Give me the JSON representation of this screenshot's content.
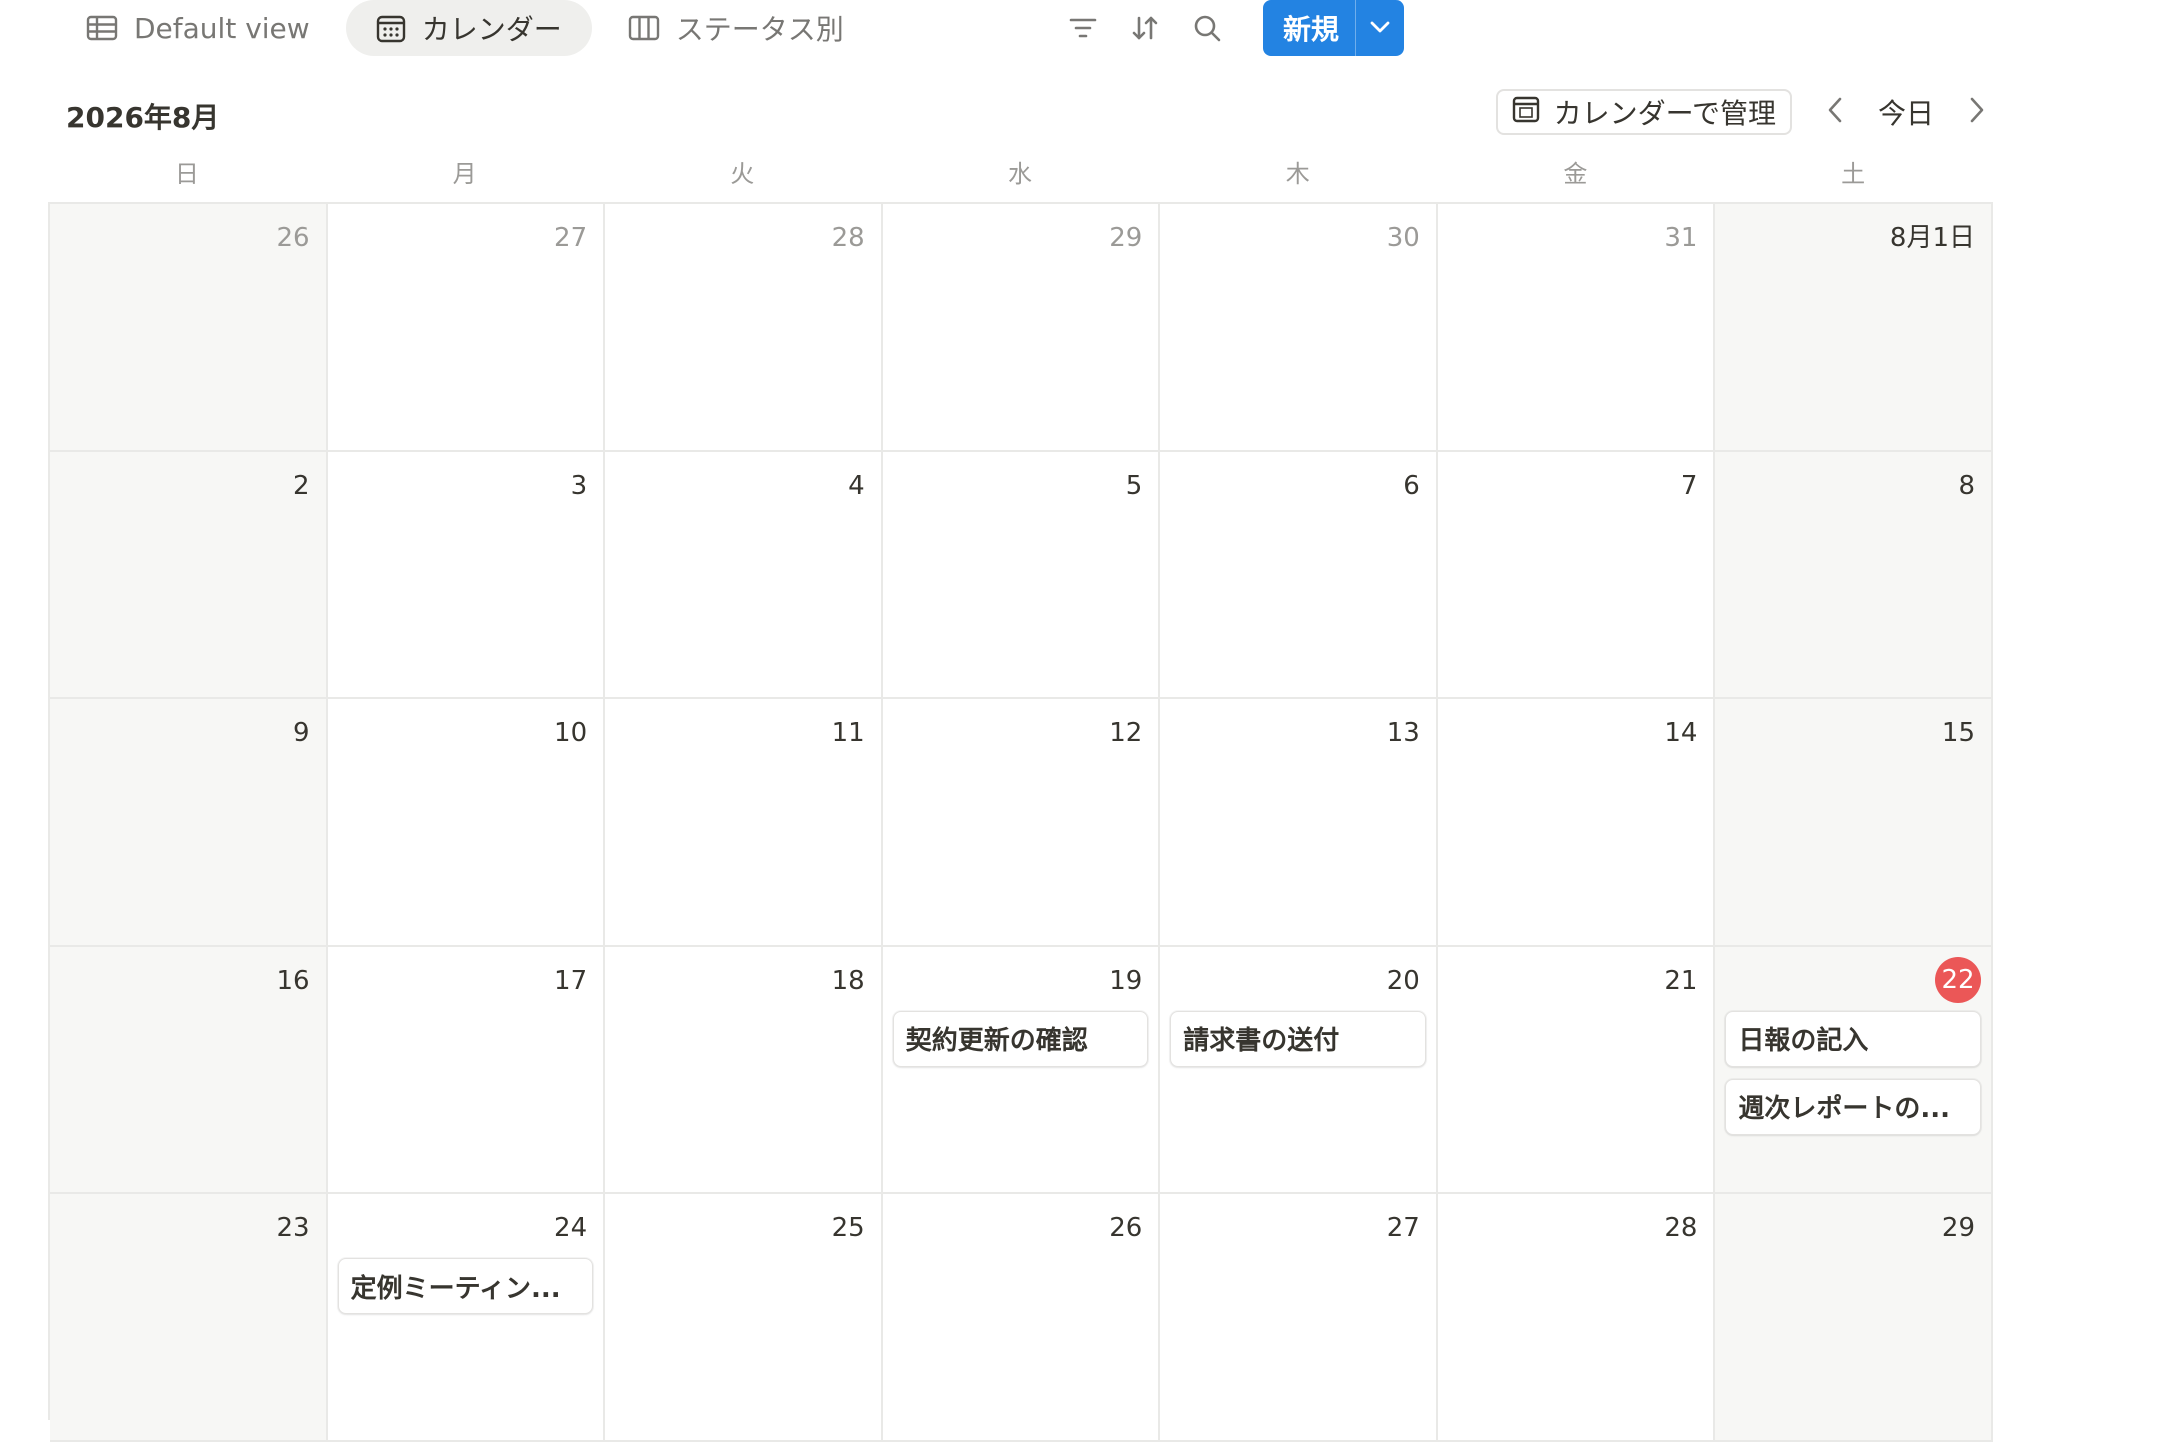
{
  "views": {
    "tabs": [
      {
        "label": "Default view",
        "icon": "table-icon"
      },
      {
        "label": "カレンダー",
        "icon": "calendar-icon"
      },
      {
        "label": "ステータス別",
        "icon": "board-icon"
      }
    ],
    "active_index": 1
  },
  "toolbar": {
    "new_label": "新規",
    "accent_color": "#2383e2"
  },
  "calendar": {
    "month_label": "2026年8月",
    "manage_label": "カレンダーで管理",
    "today_label": "今日",
    "weekdays": [
      "日",
      "月",
      "火",
      "水",
      "木",
      "金",
      "土"
    ],
    "today_color": "#eb5757",
    "weeks": [
      [
        {
          "label": "26",
          "other": true
        },
        {
          "label": "27",
          "other": true
        },
        {
          "label": "28",
          "other": true
        },
        {
          "label": "29",
          "other": true
        },
        {
          "label": "30",
          "other": true
        },
        {
          "label": "31",
          "other": true
        },
        {
          "label": "8月1日"
        }
      ],
      [
        {
          "label": "2"
        },
        {
          "label": "3"
        },
        {
          "label": "4"
        },
        {
          "label": "5"
        },
        {
          "label": "6"
        },
        {
          "label": "7"
        },
        {
          "label": "8"
        }
      ],
      [
        {
          "label": "9"
        },
        {
          "label": "10"
        },
        {
          "label": "11"
        },
        {
          "label": "12"
        },
        {
          "label": "13"
        },
        {
          "label": "14"
        },
        {
          "label": "15"
        }
      ],
      [
        {
          "label": "16"
        },
        {
          "label": "17"
        },
        {
          "label": "18"
        },
        {
          "label": "19",
          "events": [
            "契約更新の確認"
          ]
        },
        {
          "label": "20",
          "events": [
            "請求書の送付"
          ]
        },
        {
          "label": "21"
        },
        {
          "label": "22",
          "today": true,
          "events": [
            "日報の記入",
            "週次レポートの..."
          ]
        }
      ],
      [
        {
          "label": "23"
        },
        {
          "label": "24",
          "events": [
            "定例ミーティン..."
          ]
        },
        {
          "label": "25"
        },
        {
          "label": "26"
        },
        {
          "label": "27"
        },
        {
          "label": "28"
        },
        {
          "label": "29"
        }
      ]
    ]
  }
}
